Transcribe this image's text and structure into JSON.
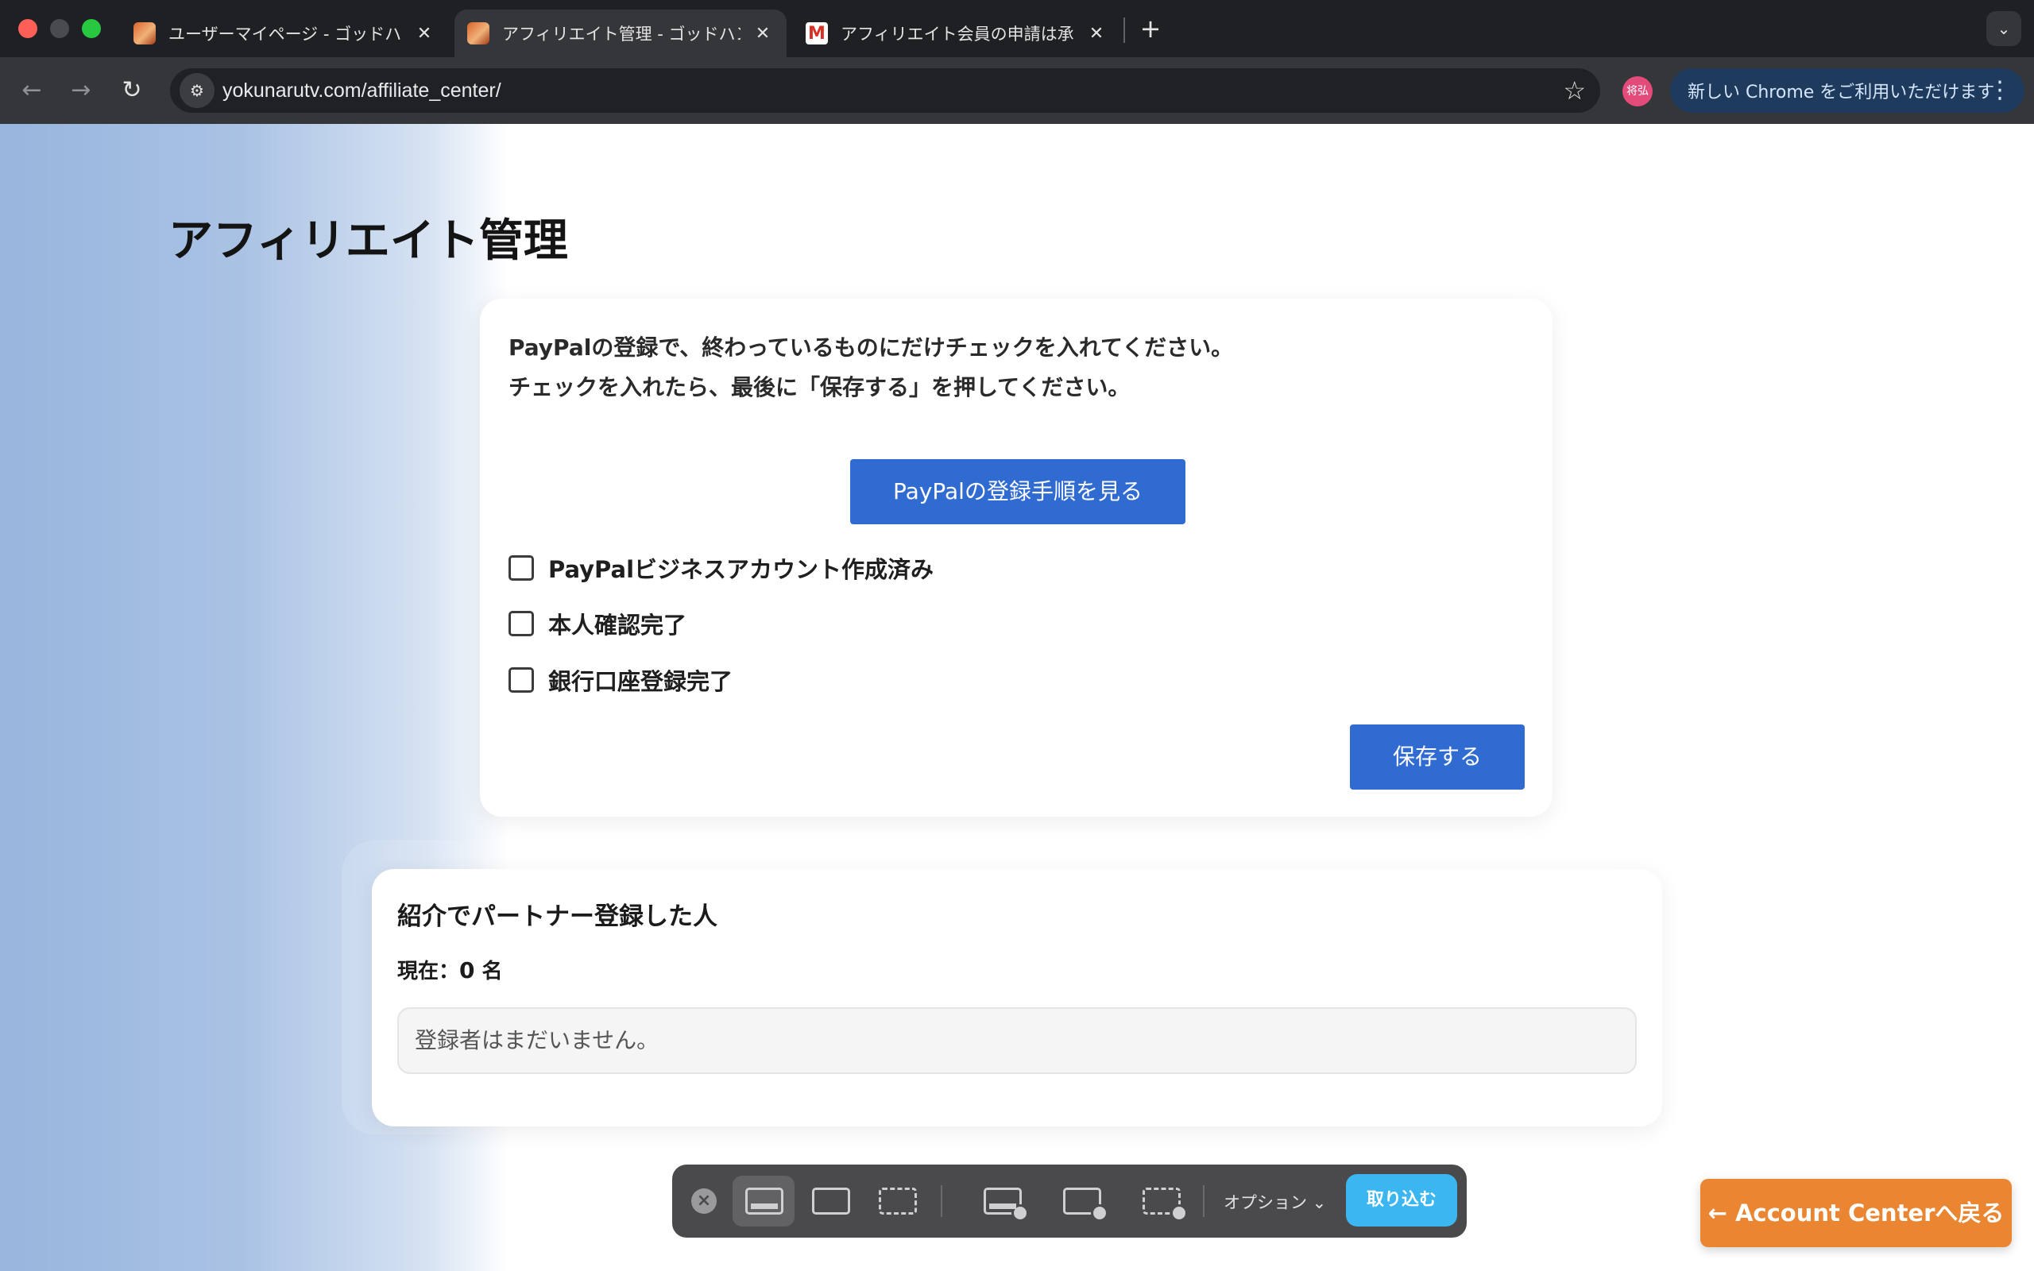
{
  "browser": {
    "tabs": [
      {
        "title": "ユーザーマイページ - ゴッドハンド"
      },
      {
        "title": "アフィリエイト管理 - ゴッドハンド"
      },
      {
        "title": "アフィリエイト会員の申請は承認"
      }
    ],
    "new_tab_glyph": "+",
    "close_glyph": "✕",
    "url": "yokunarutv.com/affiliate_center/",
    "profile_initials": "将弘",
    "update_label": "新しい Chrome をご利用いただけます"
  },
  "page": {
    "title": "アフィリエイト管理",
    "paypal": {
      "instruction_1": "PayPalの登録で、終わっているものにだけチェックを入れてください。",
      "instruction_2": "チェックを入れたら、最後に「保存する」を押してください。",
      "guide_button": "PayPalの登録手順を見る",
      "checklist": [
        {
          "label": "PayPalビジネスアカウント作成済み",
          "checked": false
        },
        {
          "label": "本人確認完了",
          "checked": false
        },
        {
          "label": "銀行口座登録完了",
          "checked": false
        }
      ],
      "save_button": "保存する"
    },
    "referrals": {
      "title": "紹介でパートナー登録した人",
      "count_prefix": "現在：",
      "count_value": "0",
      "count_suffix": " 名",
      "empty_message": "登録者はまだいません。"
    },
    "back_button": "← Account Centerへ戻る"
  },
  "capture_toolbar": {
    "options_label": "オプション ⌄",
    "capture_label": "取り込む"
  },
  "icons": {
    "back": "arrow-left-icon",
    "forward": "arrow-right-icon",
    "reload": "reload-icon",
    "site_info": "site-info-icon",
    "bookmark": "star-icon"
  },
  "colors": {
    "primary_button": "#2f6bd0",
    "back_button": "#ea8532",
    "capture_button": "#3cb6f0"
  }
}
